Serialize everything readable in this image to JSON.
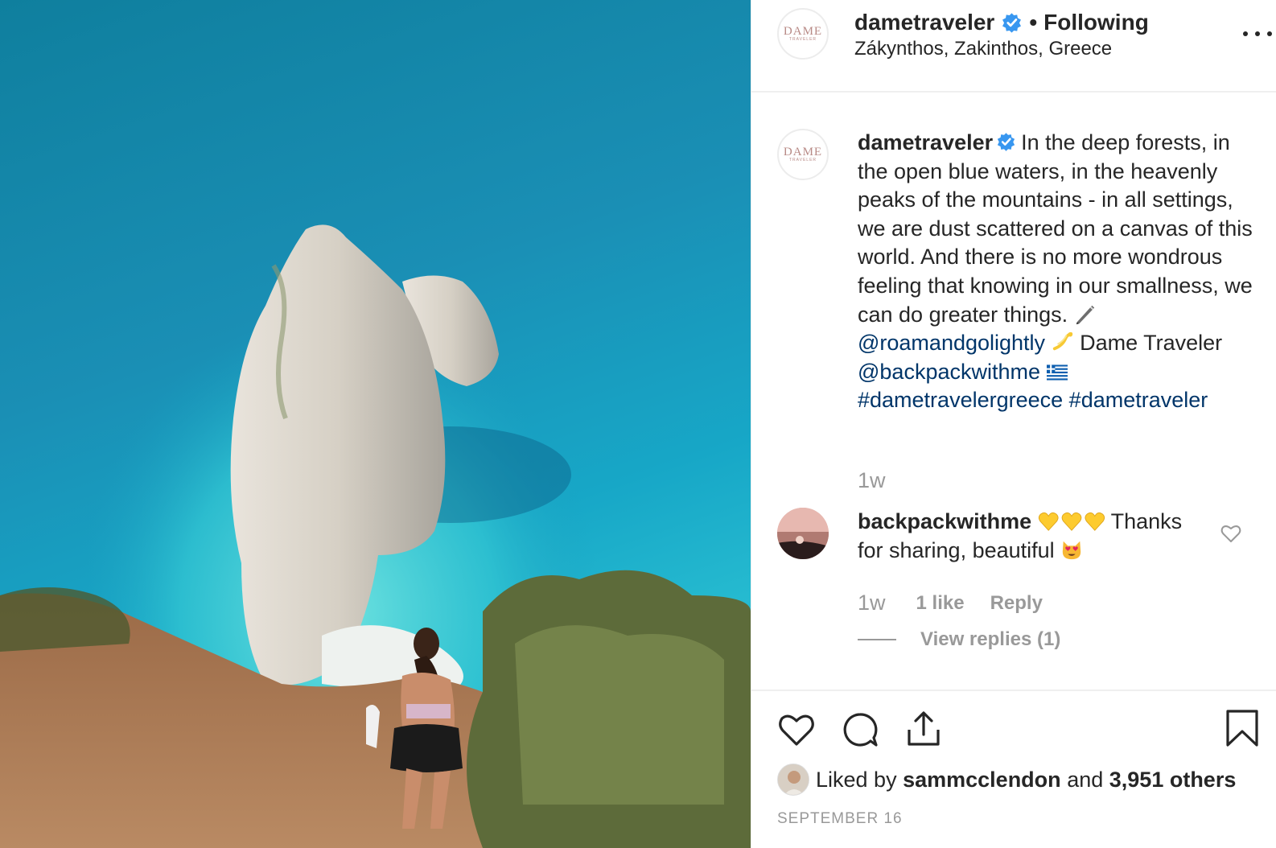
{
  "post": {
    "username": "dametraveler",
    "separator": "•",
    "follow_status": "Following",
    "location": "Zákynthos, Zakinthos, Greece",
    "logo_text_big": "DAME",
    "logo_text_small": "TRAVELER",
    "caption_text": "In the deep forests, in the open blue waters, in the heavenly peaks of the mountains - in all settings, we are dust scattered on a canvas of this world. And there is no more wondrous feeling that knowing in our smallness, we can do greater things.",
    "mention_1": "@roamandgolightly",
    "credit_text": "Dame Traveler",
    "mention_2": "@backpackwithme",
    "hashtag_1": "#dametravelergreece",
    "hashtag_2": "#dametraveler",
    "time": "1w",
    "icons": {
      "verified": "verified-badge-icon",
      "more": "more-options-icon",
      "pen": "pen-emoji",
      "dizzy": "dizzy-emoji",
      "flag": "greece-flag-emoji"
    },
    "colors": {
      "link": "#003569",
      "verified": "#3897f0",
      "muted": "#999999",
      "text": "#262626"
    }
  },
  "comment": {
    "username": "backpackwithme",
    "text_main": "Thanks for sharing, beautiful",
    "time": "1w",
    "likes": "1 like",
    "reply_label": "Reply",
    "view_replies": "View replies (1)",
    "icons": {
      "hearts": "yellow-heart-emoji",
      "cat": "heart-eyes-cat-emoji",
      "like": "heart-outline-icon"
    }
  },
  "actions": {
    "icons": [
      "heart-icon",
      "comment-icon",
      "share-icon",
      "bookmark-icon"
    ],
    "liked_by_label": "Liked by",
    "liked_by_user": "sammcclendon",
    "and_label": "and",
    "others_count": "3,951 others",
    "date": "SEPTEMBER 16"
  }
}
